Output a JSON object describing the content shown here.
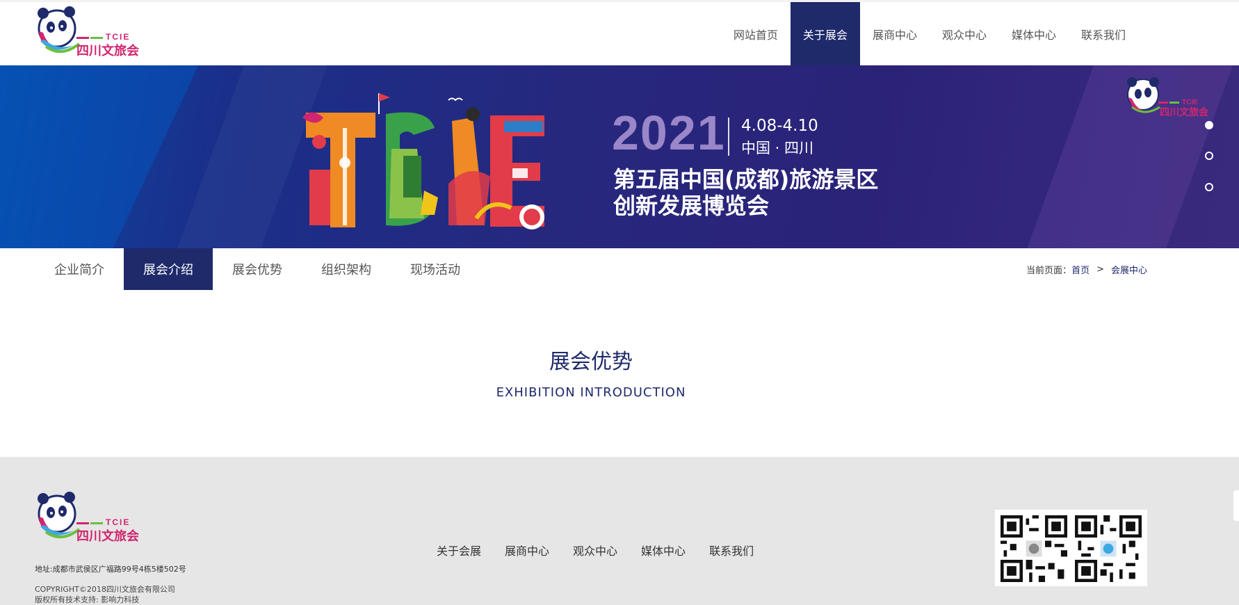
{
  "brand": {
    "logo_text": "四川文旅会",
    "logo_abbr": "TCIE",
    "colors": {
      "navy": "#1f2a6b",
      "magenta": "#d1256f",
      "green": "#6cbf3f",
      "light_blue": "#3ea8e0",
      "gray_bg": "#e6e6e6"
    }
  },
  "nav": {
    "items": [
      {
        "label": "网站首页"
      },
      {
        "label": "关于展会"
      },
      {
        "label": "展商中心"
      },
      {
        "label": "观众中心"
      },
      {
        "label": "媒体中心"
      },
      {
        "label": "联系我们"
      }
    ],
    "active_index": 1
  },
  "banner": {
    "art_text": "TCIE",
    "year": "2021",
    "date": "4.08-4.10",
    "place": "中国 · 四川",
    "title_line1": "第五届中国(成都)旅游景区",
    "title_line2": "创新发展博览会",
    "slide_count": 3,
    "active_slide": 0
  },
  "subnav": {
    "tabs": [
      {
        "label": "企业简介"
      },
      {
        "label": "展会介绍"
      },
      {
        "label": "展会优势"
      },
      {
        "label": "组织架构"
      },
      {
        "label": "现场活动"
      }
    ],
    "active_index": 1
  },
  "breadcrumb": {
    "prefix": "当前页面：",
    "home": "首页",
    "separator": ">",
    "current": "会展中心"
  },
  "section": {
    "title": "展会优势",
    "subtitle": "EXHIBITION INTRODUCTION"
  },
  "footer": {
    "address": "地址:成都市武侯区广福路99号4栋5楼502号",
    "copyright": "COPYRIGHT©2018四川文旅会有限公司",
    "tech_support": "版权所有技术支持: 影响力科技",
    "links": [
      {
        "label": "关于会展"
      },
      {
        "label": "展商中心"
      },
      {
        "label": "观众中心"
      },
      {
        "label": "媒体中心"
      },
      {
        "label": "联系我们"
      }
    ],
    "qr_codes": [
      {
        "icon": "qr-code-icon"
      },
      {
        "icon": "qr-code-icon"
      }
    ]
  }
}
